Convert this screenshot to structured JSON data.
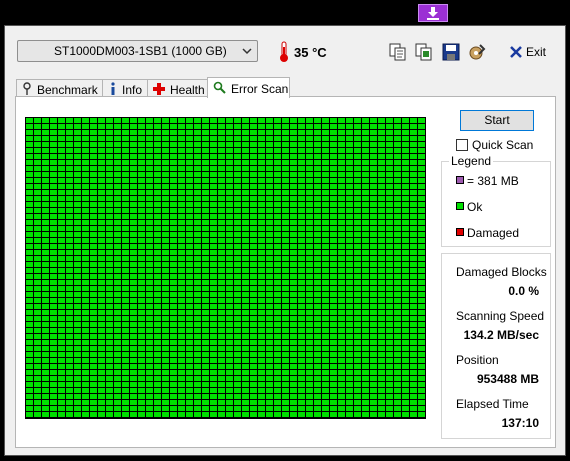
{
  "drive": {
    "selected": "ST1000DM003-1SB1 (1000 GB)"
  },
  "temperature": "35 °C",
  "toolbar": {
    "exit_label": "Exit",
    "icons": [
      "copy-text-icon",
      "copy-image-icon",
      "save-icon",
      "options-icon",
      "close-x-icon"
    ]
  },
  "tabs": [
    {
      "label": "Benchmark",
      "icon": "benchmark-icon"
    },
    {
      "label": "Info",
      "icon": "info-icon"
    },
    {
      "label": "Health",
      "icon": "health-cross-icon"
    },
    {
      "label": "Error Scan",
      "icon": "magnifier-icon",
      "active": true
    }
  ],
  "scan": {
    "start_label": "Start",
    "quick_scan_label": "Quick Scan",
    "quick_scan_checked": false,
    "block_color": "#00e000",
    "legend": {
      "title": "Legend",
      "items": [
        {
          "label": "= 381 MB",
          "color": "#9e5bb0"
        },
        {
          "label": "Ok",
          "color": "#00e000"
        },
        {
          "label": "Damaged",
          "color": "#e00000"
        }
      ]
    },
    "stats": {
      "damaged_blocks_label": "Damaged Blocks",
      "damaged_blocks_value": "0.0 %",
      "speed_label": "Scanning Speed",
      "speed_value": "134.2 MB/sec",
      "position_label": "Position",
      "position_value": "953488 MB",
      "elapsed_label": "Elapsed Time",
      "elapsed_value": "137:10"
    }
  }
}
